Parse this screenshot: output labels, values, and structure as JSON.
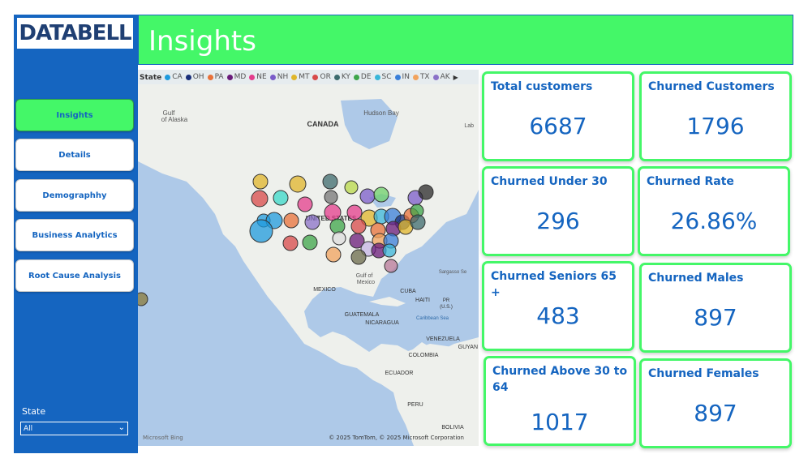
{
  "brand": {
    "logo_text": "DATABELL"
  },
  "header": {
    "title": "Insights"
  },
  "nav": {
    "items": [
      {
        "label": "Insights",
        "active": true
      },
      {
        "label": "Details",
        "active": false
      },
      {
        "label": "Demographhy",
        "active": false
      },
      {
        "label": "Business Analytics",
        "active": false
      },
      {
        "label": "Root Cause Analysis",
        "active": false
      }
    ]
  },
  "filter": {
    "label": "State",
    "value": "All"
  },
  "map": {
    "legend_title": "State",
    "legend": [
      {
        "name": "CA",
        "color": "#1f9bde"
      },
      {
        "name": "OH",
        "color": "#1a2f7a"
      },
      {
        "name": "PA",
        "color": "#e8713a"
      },
      {
        "name": "MD",
        "color": "#6a1b7a"
      },
      {
        "name": "NE",
        "color": "#e43d8c"
      },
      {
        "name": "NH",
        "color": "#7b5cc9"
      },
      {
        "name": "MT",
        "color": "#e0b62b"
      },
      {
        "name": "OR",
        "color": "#d84a4a"
      },
      {
        "name": "KY",
        "color": "#3d6b6e"
      },
      {
        "name": "DE",
        "color": "#3ea64a"
      },
      {
        "name": "SC",
        "color": "#39b6d9"
      },
      {
        "name": "IN",
        "color": "#3a7fd9"
      },
      {
        "name": "TX",
        "color": "#f2a35d"
      },
      {
        "name": "AK",
        "color": "#8b72c8"
      }
    ],
    "labels": {
      "canada": "CANADA",
      "usa": "UNITED STATES",
      "mexico": "MEXICO",
      "gulf_alaska_1": "Gulf",
      "gulf_alaska_2": "of Alaska",
      "hudson": "Hudson Bay",
      "gulf_mexico_1": "Gulf of",
      "gulf_mexico_2": "Mexico",
      "cuba": "CUBA",
      "haiti": "HAITI",
      "pr_1": "PR",
      "pr_2": "(U.S.)",
      "guatemala": "GUATEMALA",
      "nicaragua": "NICARAGUA",
      "caribbean": "Caribbean Sea",
      "venezuela": "VENEZUELA",
      "colombia": "COLOMBIA",
      "guyana": "GUYAN",
      "ecuador": "ECUADOR",
      "peru": "PERU",
      "bolivia": "BOLIVIA",
      "sargasso": "Sargasso Se",
      "lab": "Lab"
    },
    "credit": "© 2025 TomTom, © 2025 Microsoft Corporation",
    "bing": "Microsoft Bing"
  },
  "cards": [
    {
      "title": "Total customers",
      "value": "6687"
    },
    {
      "title": "Churned Customers",
      "value": "1796"
    },
    {
      "title": "Churned Under 30",
      "value": "296"
    },
    {
      "title": "Churned Rate",
      "value": "26.86%"
    },
    {
      "title": "Churned Seniors 65 +",
      "value": "483"
    },
    {
      "title": "Churned Males",
      "value": "897"
    },
    {
      "title": "Churned Above 30 to 64",
      "value": "1017"
    },
    {
      "title": "Churned Females",
      "value": "897"
    }
  ],
  "colors": {
    "accent_green": "#44f768",
    "brand_blue": "#1565c0"
  }
}
